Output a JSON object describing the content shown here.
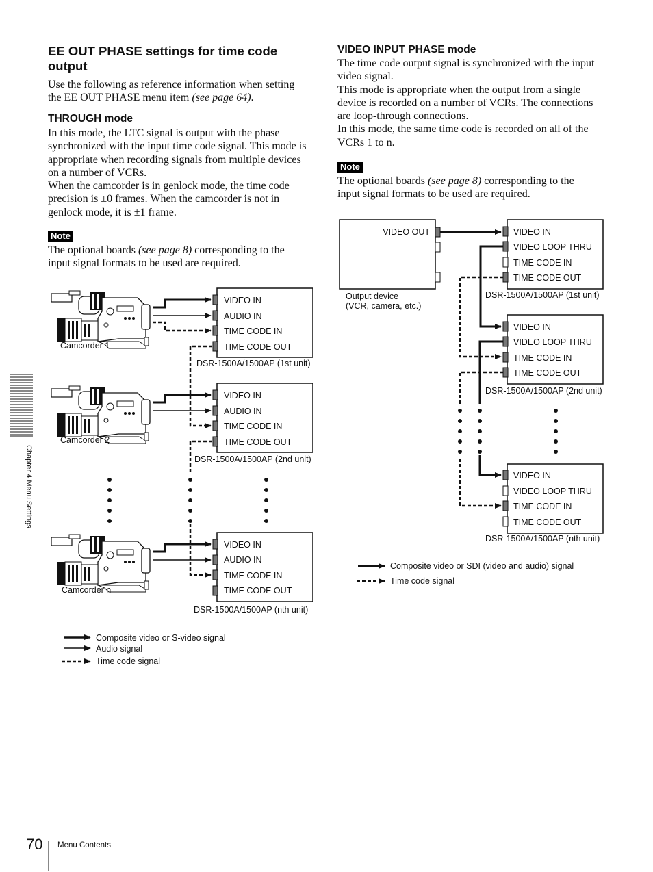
{
  "left": {
    "heading": "EE OUT PHASE settings for time code output",
    "heading_line1": "EE OUT PHASE settings for time code",
    "heading_line2": "output",
    "intro": [
      "Use the following as reference information when setting",
      "the EE OUT PHASE menu item ",
      "(see page 64)",
      "."
    ],
    "through_title": "THROUGH mode",
    "through_lines": [
      "In this mode, the LTC signal is output with the phase",
      "synchronized with the input time code signal. This mode is",
      "appropriate when recording signals from multiple devices",
      "on a number of VCRs.",
      "When the camcorder is in genlock mode, the time code",
      "precision is ±0 frames. When the camcorder is not in",
      "genlock mode, it is ±1 frame."
    ],
    "note_label": "Note",
    "note_lines": [
      "The optional boards ",
      "(see page 8)",
      " corresponding to the",
      "input signal formats to be used are required."
    ]
  },
  "right": {
    "vip_title": "VIDEO INPUT PHASE mode",
    "vip_lines": [
      "The time code output signal is synchronized with the input",
      "video signal.",
      "This mode is appropriate when the output from a single",
      "device is recorded on a number of VCRs. The connections",
      "are loop-through connections.",
      "In this mode, the same time code is recorded on all of the",
      "VCRs 1 to n."
    ],
    "note_label": "Note",
    "note_lines": [
      "The optional boards ",
      "(see page 8)",
      " corresponding to the",
      "input signal formats to be used are required."
    ]
  },
  "diagram_through": {
    "camcorders": [
      "Camcorder 1",
      "Camcorder 2",
      "Camcorder n"
    ],
    "unit_ports": [
      "VIDEO IN",
      "AUDIO IN",
      "TIME CODE IN",
      "TIME CODE OUT"
    ],
    "units": [
      "DSR-1500A/1500AP (1st unit)",
      "DSR-1500A/1500AP (2nd unit)",
      "DSR-1500A/1500AP (nth unit)"
    ],
    "legend": [
      "Composite video or S-video signal",
      "Audio signal",
      "Time code signal"
    ]
  },
  "diagram_vip": {
    "output_device_port": "VIDEO OUT",
    "output_device_label": [
      "Output device",
      "(VCR, camera, etc.)"
    ],
    "unit_ports": [
      "VIDEO IN",
      "VIDEO LOOP THRU",
      "TIME CODE IN",
      "TIME CODE OUT"
    ],
    "units": [
      "DSR-1500A/1500AP (1st unit)",
      "DSR-1500A/1500AP (2nd unit)",
      "DSR-1500A/1500AP (nth unit)"
    ],
    "legend": [
      "Composite video or SDI (video and audio) signal",
      "Time code signal"
    ]
  },
  "side_tab": "Chapter 4   Menu Settings",
  "footer": {
    "page_number": "70",
    "section": "Menu Contents"
  }
}
